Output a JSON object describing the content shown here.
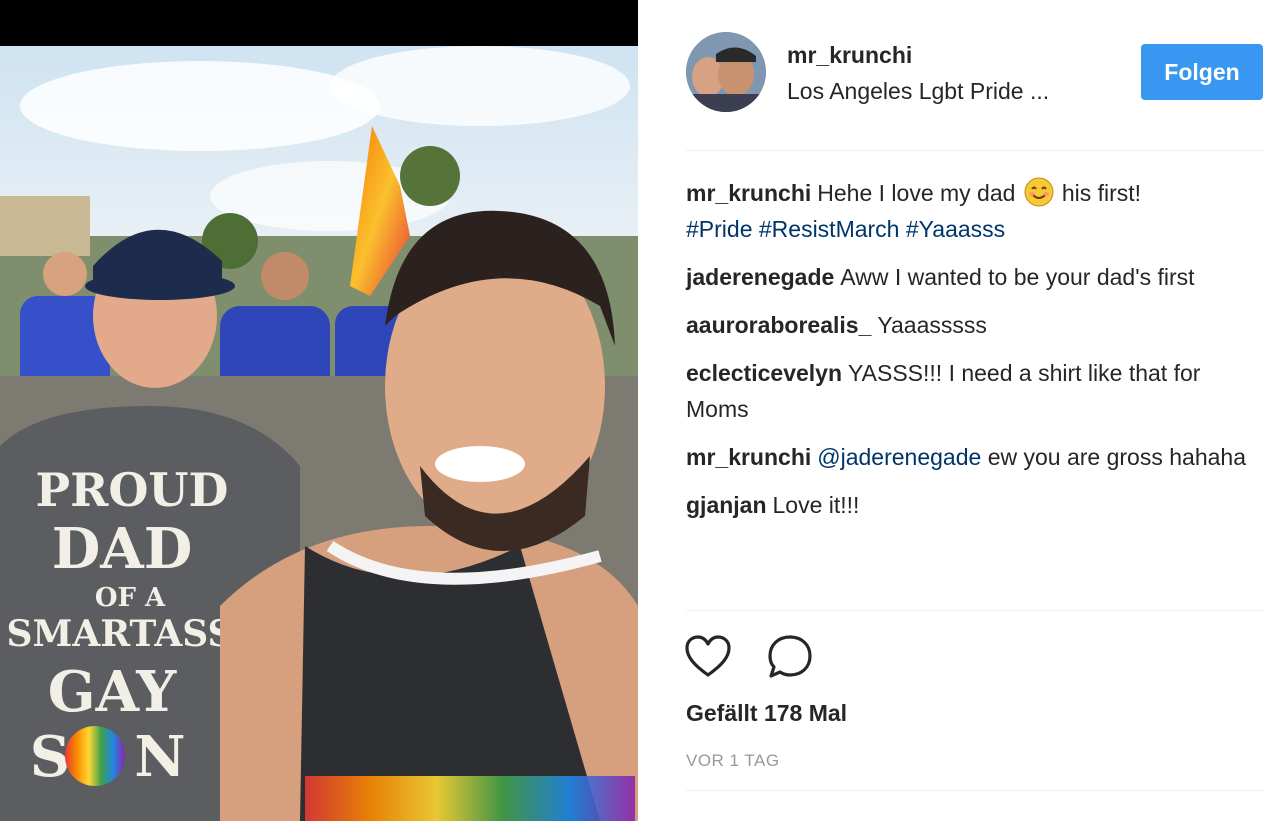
{
  "post": {
    "username": "mr_krunchi",
    "location": "Los Angeles Lgbt Pride ...",
    "follow_label": "Folgen",
    "photo_shirt_text": [
      "PROUD",
      "DAD",
      "OF A",
      "SMARTASS",
      "GAY",
      "S",
      "N"
    ],
    "caption": {
      "user": "mr_krunchi",
      "text_before_emoji": "Hehe I love my dad",
      "emoji": "smiling-face-emoji",
      "text_after_emoji": "his first!",
      "hashtags": "#Pride #ResistMarch #Yaaasss"
    },
    "comments": [
      {
        "user": "jaderenegade",
        "text": "Aww I wanted to be your dad's first"
      },
      {
        "user": "aauroraborealis_",
        "text": "Yaaasssss"
      },
      {
        "user": "eclecticevelyn",
        "text": "YASSS!!! I need a shirt like that for Moms"
      },
      {
        "user": "mr_krunchi",
        "mention": "@jaderenegade",
        "text": "ew you are gross hahaha"
      },
      {
        "user": "gjanjan",
        "text": "Love it!!!"
      }
    ],
    "likes_text": "Gefällt 178 Mal",
    "timestamp": "VOR 1 TAG",
    "icons": {
      "like": "heart-icon",
      "comment": "comment-bubble-icon"
    },
    "colors": {
      "follow_button": "#3897f0",
      "hashtag": "#003569",
      "text": "#262626",
      "muted": "#999999"
    }
  }
}
